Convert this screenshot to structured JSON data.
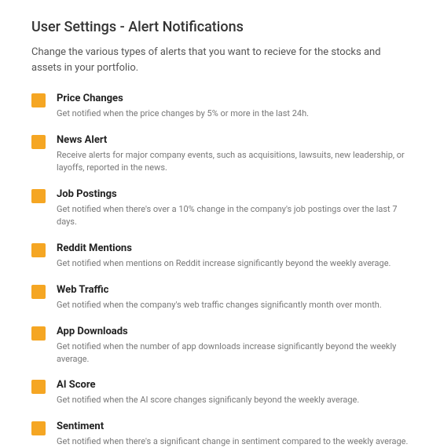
{
  "header": {
    "title": "User Settings - Alert Notifications",
    "description": "Change the various types of alerts that you want to recieve for the stocks and assets in your portfolio."
  },
  "alerts": [
    {
      "title": "Price Changes",
      "description": "Get notified when the price changes by 5% or more in the last 24h."
    },
    {
      "title": "News Alert",
      "description": "Receive alerts for major company events, such as acquisitions, lawsuits, new leadership, or layoffs, reported in the news."
    },
    {
      "title": "Job Postings",
      "description": "Get notified when there's over a 10% change in the company's job postings over the last 7 days."
    },
    {
      "title": "Reddit Mentions",
      "description": "Get notified when mentions on Reddit increase significantly beyond the weekly average."
    },
    {
      "title": "Web Traffic",
      "description": "Get notified when the company's web traffic changes significantly month over month."
    },
    {
      "title": "App Downloads",
      "description": "Get notified when the number of app downloads increase significantly beyond the weekly average."
    },
    {
      "title": "AI Score",
      "description": "Get notified when the AI score changes significanly beyond the weekly average."
    },
    {
      "title": "Sentiment",
      "description": "Get notified when there's a significant change in sentiment compared to the weekly average."
    }
  ]
}
